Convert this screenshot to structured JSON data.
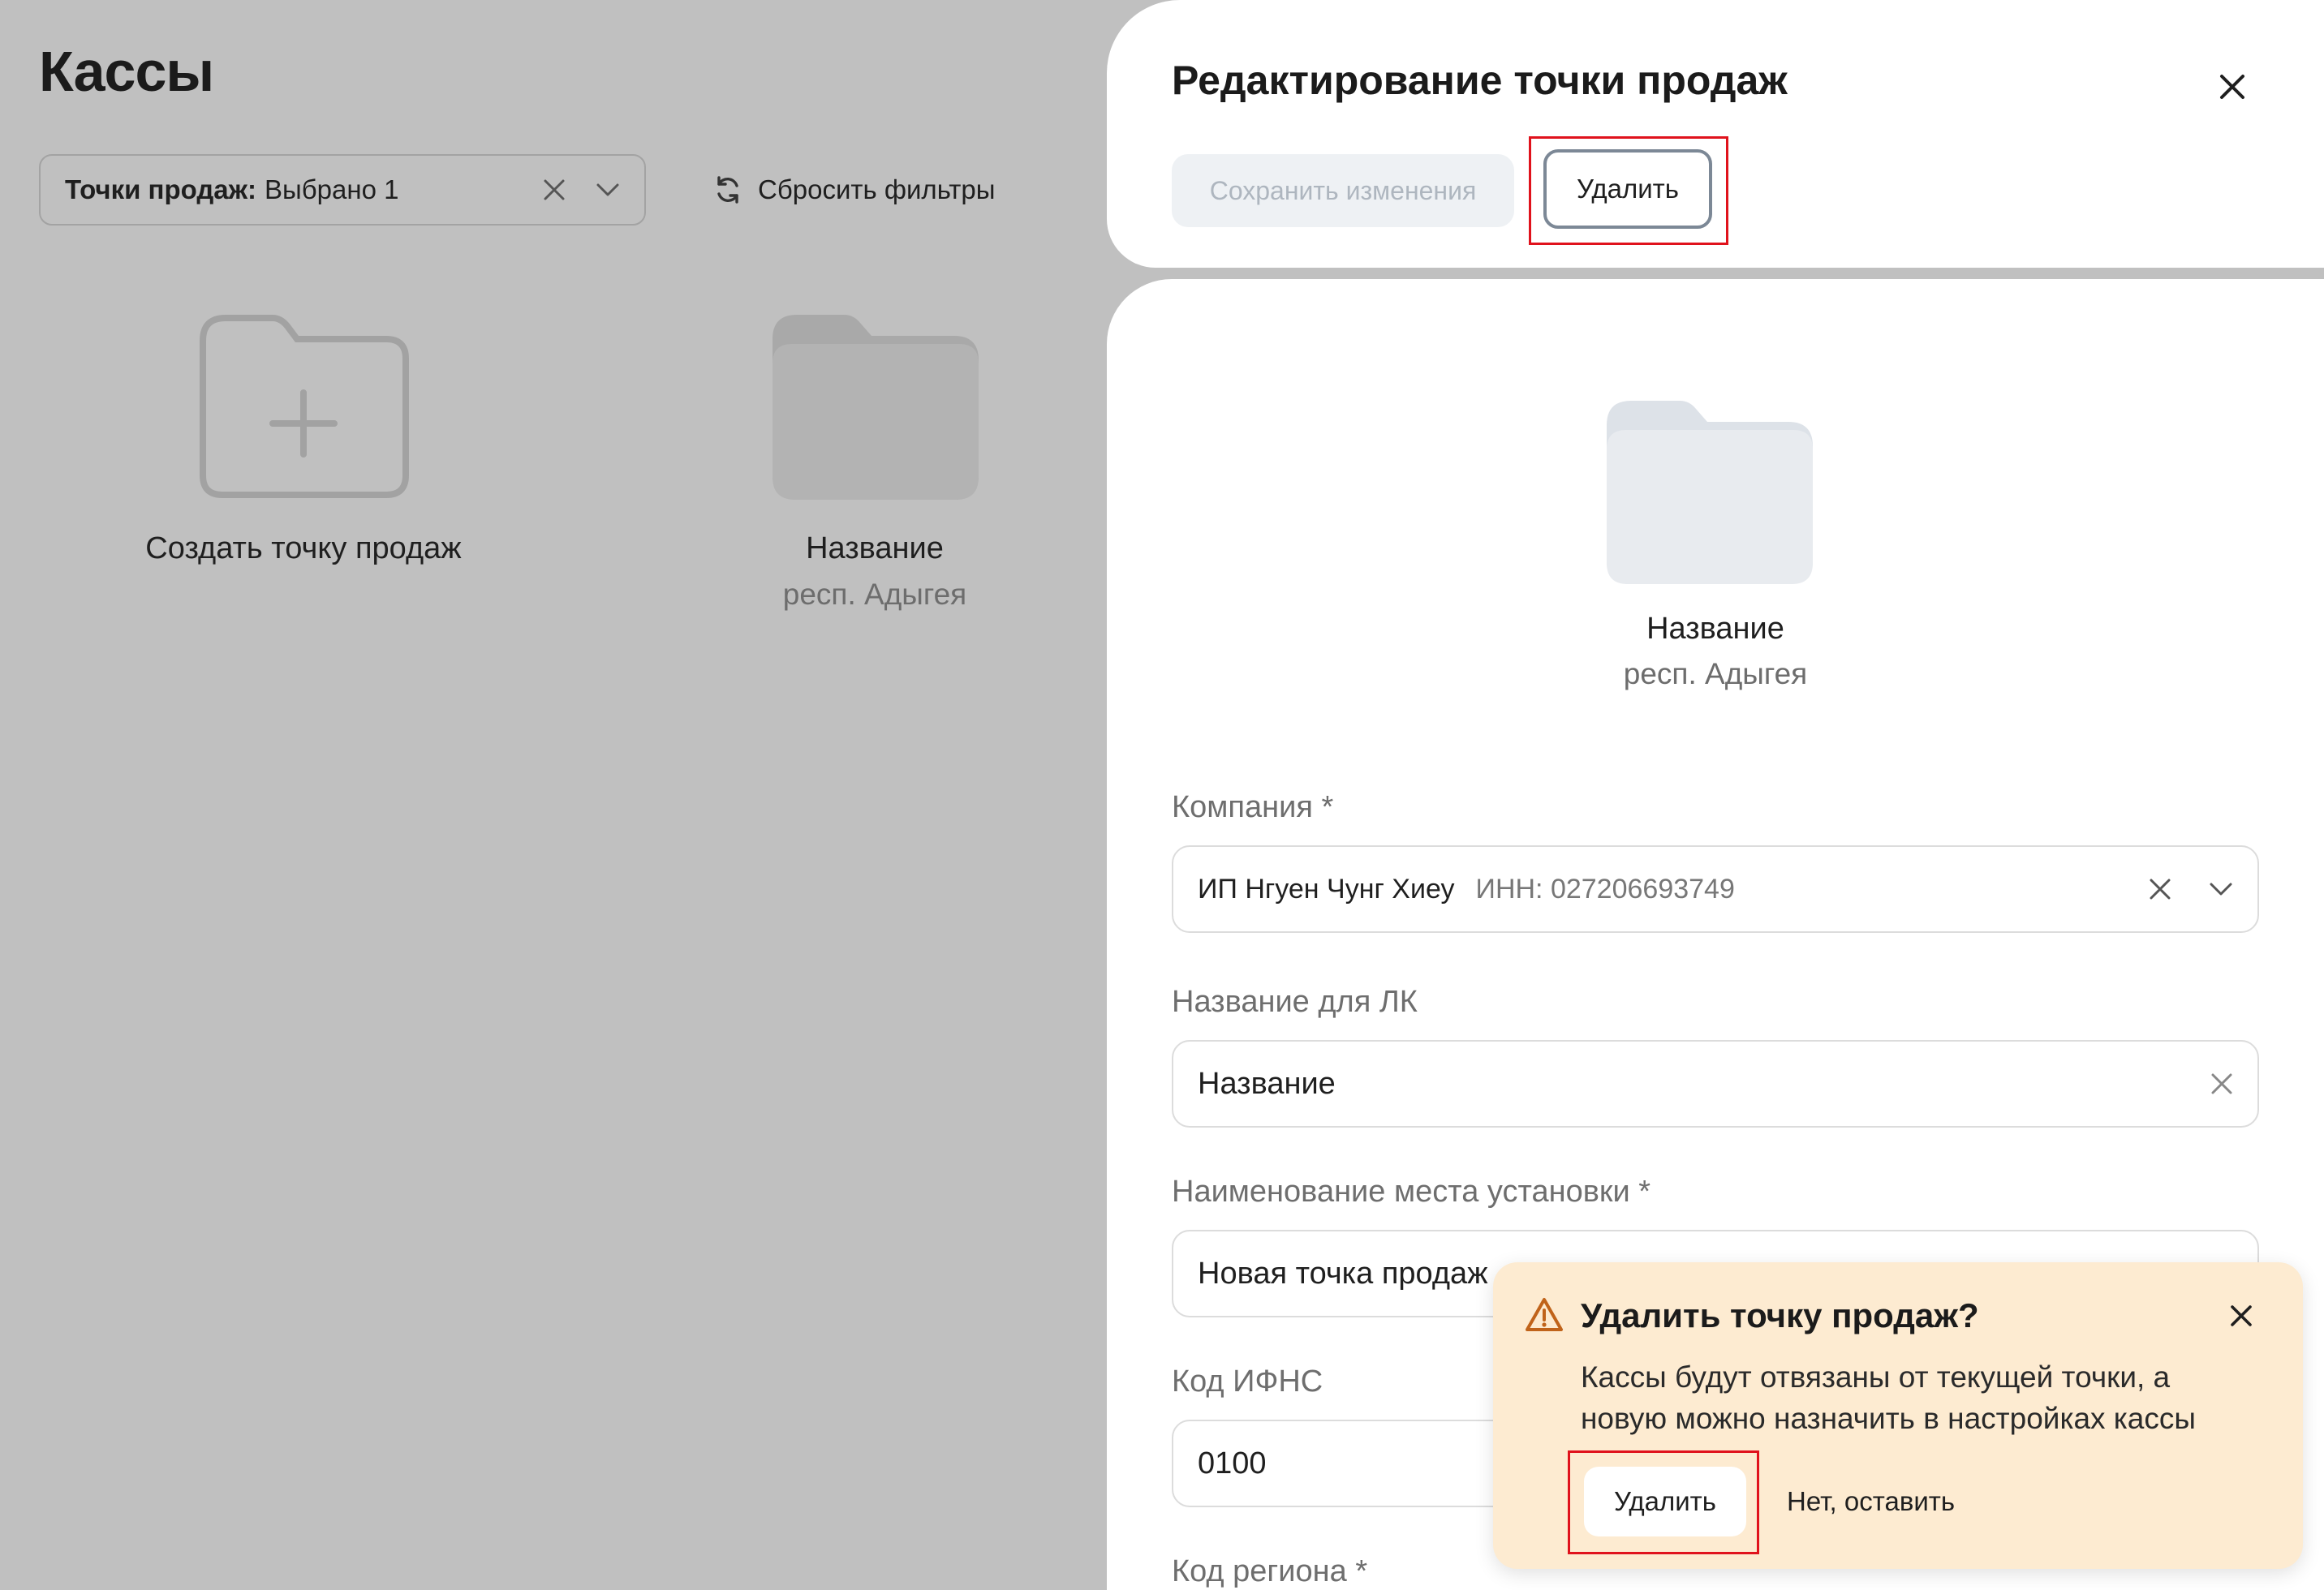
{
  "page": {
    "title": "Кассы"
  },
  "filters": {
    "points_label": "Точки продаж:",
    "points_value": "Выбрано 1",
    "reset_label": "Сбросить фильтры"
  },
  "tiles": [
    {
      "title": "Создать точку продаж"
    },
    {
      "title": "Название",
      "subtitle": "респ. Адыгея"
    }
  ],
  "panel": {
    "title": "Редактирование точки продаж",
    "save_label": "Сохранить изменения",
    "delete_label": "Удалить",
    "point_name": "Название",
    "point_region": "респ. Адыгея",
    "fields": {
      "company": {
        "label": "Компания *",
        "value": "ИП Нгуен Чунг Хиеу",
        "inn": "ИНН: 027206693749"
      },
      "lk_name": {
        "label": "Название для ЛК",
        "value": "Название"
      },
      "install_place": {
        "label": "Наименование места установки *",
        "value": "Новая точка продаж"
      },
      "ifns_code": {
        "label": "Код ИФНС",
        "value": "0100"
      },
      "region_code": {
        "label": "Код региона *"
      }
    }
  },
  "popover": {
    "title": "Удалить точку продаж?",
    "text": "Кассы будут отвязаны от текущей точки, а новую можно назначить в настройках кассы",
    "delete_label": "Удалить",
    "keep_label": "Нет, оставить"
  },
  "colors": {
    "overlay": "#c0c0c0",
    "popover_bg": "#fdebd1",
    "highlight": "#e0121c",
    "warning_icon": "#c0631a"
  }
}
